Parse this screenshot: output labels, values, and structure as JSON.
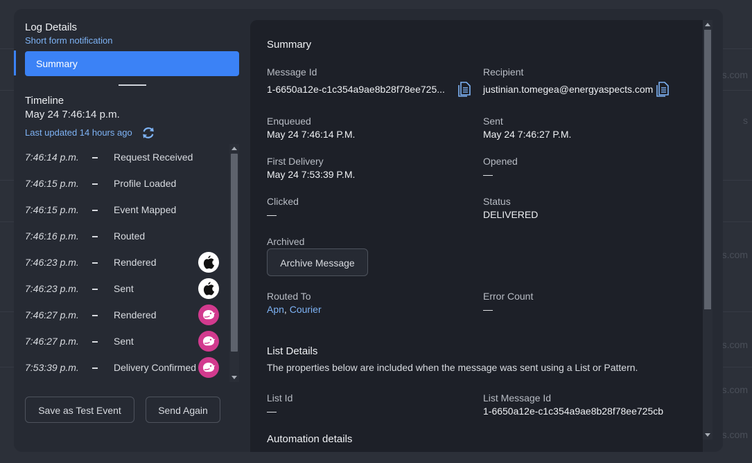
{
  "background": {
    "peek_texts": [
      "s.com",
      "s",
      "s.com",
      "s.com",
      "s.com",
      "s.com"
    ]
  },
  "left": {
    "title": "Log Details",
    "subtitle": "Short form notification",
    "tab_label": "Summary",
    "timeline_title": "Timeline",
    "timeline_date": "May 24 7:46:14 p.m.",
    "last_updated": "Last updated 14 hours ago",
    "events": [
      {
        "time": "7:46:14 p.m.",
        "event": "Request Received",
        "icon": ""
      },
      {
        "time": "7:46:15 p.m.",
        "event": "Profile Loaded",
        "icon": ""
      },
      {
        "time": "7:46:15 p.m.",
        "event": "Event Mapped",
        "icon": ""
      },
      {
        "time": "7:46:16 p.m.",
        "event": "Routed",
        "icon": ""
      },
      {
        "time": "7:46:23 p.m.",
        "event": "Rendered",
        "icon": "apple-icon"
      },
      {
        "time": "7:46:23 p.m.",
        "event": "Sent",
        "icon": "apple-icon"
      },
      {
        "time": "7:46:27 p.m.",
        "event": "Rendered",
        "icon": "courier-icon"
      },
      {
        "time": "7:46:27 p.m.",
        "event": "Sent",
        "icon": "courier-icon"
      },
      {
        "time": "7:53:39 p.m.",
        "event": "Delivery Confirmed",
        "icon": "courier-icon"
      }
    ],
    "save_test_label": "Save as Test Event",
    "send_again_label": "Send Again"
  },
  "summary": {
    "heading": "Summary",
    "message_id_label": "Message Id",
    "message_id_value": "1-6650a12e-c1c354a9ae8b28f78ee725...",
    "recipient_label": "Recipient",
    "recipient_value": "justinian.tomegea@energyaspects.com",
    "enqueued_label": "Enqueued",
    "enqueued_value": "May 24 7:46:14 P.M.",
    "sent_label": "Sent",
    "sent_value": "May 24 7:46:27 P.M.",
    "first_delivery_label": "First Delivery",
    "first_delivery_value": "May 24 7:53:39 P.M.",
    "opened_label": "Opened",
    "opened_value": "—",
    "clicked_label": "Clicked",
    "clicked_value": "—",
    "status_label": "Status",
    "status_value": "DELIVERED",
    "archived_label": "Archived",
    "archive_button": "Archive Message",
    "routed_to_label": "Routed To",
    "routed_to_apn": "Apn",
    "routed_to_sep": ", ",
    "routed_to_courier": "Courier",
    "error_count_label": "Error Count",
    "error_count_value": "—"
  },
  "list_details": {
    "heading": "List Details",
    "description": "The properties below are included when the message was sent using a List or Pattern.",
    "list_id_label": "List Id",
    "list_id_value": "—",
    "list_message_id_label": "List Message Id",
    "list_message_id_value": "1-6650a12e-c1c354a9ae8b28f78ee725cb"
  },
  "automation": {
    "heading": "Automation details"
  },
  "colors": {
    "accent": "#3b82f6",
    "link": "#7eb3f5",
    "courier_brand": "#d23a8e"
  }
}
